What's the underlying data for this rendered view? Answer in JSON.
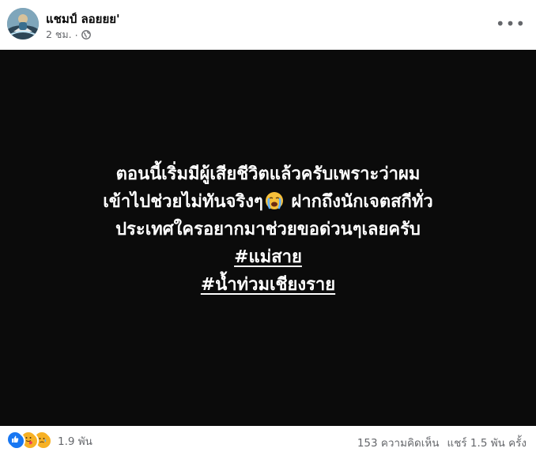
{
  "post": {
    "author": "แชมป์ ลอยยย'",
    "time": "2 ชม.",
    "separator": "·",
    "privacy_icon": "globe-icon",
    "more_icon": "more-icon"
  },
  "card": {
    "background": "#0b0b0b",
    "text_color": "#ffffff",
    "line1": "ตอนนี้เริ่มมีผู้เสียชีวิตแล้วครับเพราะว่าผม",
    "line2_start": "เข้าไปช่วยไม่ทันจริงๆ",
    "line2_emoji": "crying-face",
    "line2_end": " ฝากถึงนักเจตสกีทั่ว",
    "line3": "ประเทศใครอยากมาช่วยขอด่วนๆเลยครับ",
    "hashtags": [
      "#แม่สาย",
      "#น้ำท่วมเชียงราย"
    ]
  },
  "footer": {
    "reaction_icons": [
      "like-icon",
      "care-icon",
      "sad-icon"
    ],
    "reaction_count": "1.9 พัน",
    "comments": "153 ความคิดเห็น",
    "shares": "แชร์ 1.5 พัน ครั้ง"
  },
  "colors": {
    "like": "#1877f2",
    "reaction_yellow": "#f7b125",
    "meta_text": "#65676b"
  }
}
